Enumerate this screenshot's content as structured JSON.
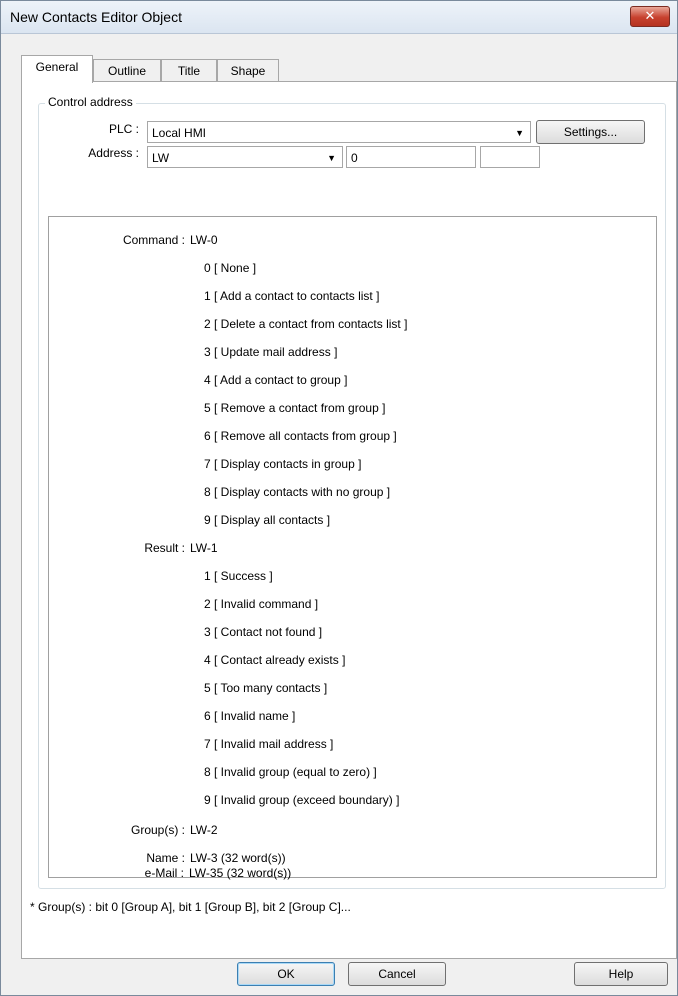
{
  "window": {
    "title": "New Contacts Editor Object"
  },
  "tabs": [
    "General",
    "Outline",
    "Title",
    "Shape"
  ],
  "control_address": {
    "legend": "Control address",
    "plc_label": "PLC :",
    "plc_value": "Local HMI",
    "settings_label": "Settings...",
    "address_label": "Address :",
    "address_type": "LW",
    "address_value": "0",
    "address_extra": ""
  },
  "info": {
    "command_key": "Command :",
    "command_val": "LW-0",
    "commands": [
      "0 [ None ]",
      "1 [ Add a contact to contacts list ]",
      "2 [ Delete a contact from contacts list ]",
      "3 [ Update mail address ]",
      "4 [ Add a contact to group ]",
      "5 [ Remove a contact from group ]",
      "6 [ Remove all contacts from group ]",
      "7 [ Display contacts in group ]",
      "8 [ Display contacts with no group ]",
      "9 [ Display all contacts ]"
    ],
    "result_key": "Result :",
    "result_val": "LW-1",
    "results": [
      "1 [ Success ]",
      "2 [ Invalid command ]",
      "3 [ Contact not found ]",
      "4 [ Contact already exists ]",
      "5 [ Too many contacts ]",
      "6 [ Invalid name ]",
      "7 [ Invalid mail address ]",
      "8 [ Invalid group (equal to zero) ]",
      "9 [ Invalid group (exceed boundary) ]"
    ],
    "group_key": "Group(s) :",
    "group_val": "LW-2",
    "name_key": "Name :",
    "name_val": "LW-3 (32 word(s))",
    "email_key": "e-Mail :",
    "email_val": "LW-35 (32 word(s))"
  },
  "footnote": "* Group(s) : bit 0 [Group A], bit 1 [Group B], bit 2 [Group C]...",
  "buttons": {
    "ok": "OK",
    "cancel": "Cancel",
    "help": "Help"
  },
  "icons": {
    "close": "close-icon",
    "dropdown": "chevron-down-icon"
  }
}
